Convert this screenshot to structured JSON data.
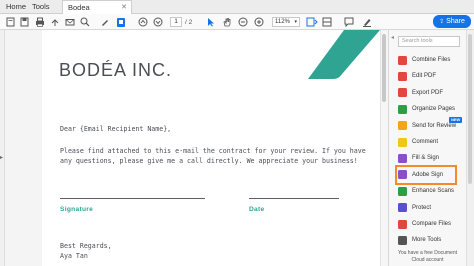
{
  "tabs": {
    "home": "Home",
    "tools": "Tools",
    "document": "Bodea Contract.pdf"
  },
  "toolbar": {
    "page_current": "1",
    "page_total": "/ 2",
    "zoom": "112%",
    "share_label": "Share"
  },
  "document": {
    "logo": "BODÉA INC.",
    "greeting": "Dear {Email Recipient Name},",
    "body_line1": "Please find attached to this e-mail the contract for your review. If you have",
    "body_line2": "any questions, please give me a call directly. We appreciate your business!",
    "signature_label": "Signature",
    "date_label": "Date",
    "closing": "Best Regards,",
    "closing_name": "Aya Tan",
    "accent_color": "#2fa492"
  },
  "tools_panel": {
    "search_placeholder": "Search tools",
    "items": [
      {
        "label": "Combine Files",
        "icon": "combine-files-icon",
        "color": "#e0473e"
      },
      {
        "label": "Edit PDF",
        "icon": "edit-pdf-icon",
        "color": "#e0473e"
      },
      {
        "label": "Export PDF",
        "icon": "export-pdf-icon",
        "color": "#e0473e"
      },
      {
        "label": "Organize Pages",
        "icon": "organize-pages-icon",
        "color": "#2e9e45"
      },
      {
        "label": "Send for Review",
        "icon": "send-for-review-icon",
        "color": "#f2a516"
      },
      {
        "label": "Comment",
        "icon": "comment-icon",
        "color": "#f2c516"
      },
      {
        "label": "Fill & Sign",
        "icon": "fill-sign-icon",
        "color": "#8a4fc9"
      },
      {
        "label": "Adobe Sign",
        "icon": "adobe-sign-icon",
        "color": "#8a4fc9"
      },
      {
        "label": "Enhance Scans",
        "icon": "enhance-scans-icon",
        "color": "#2e9e45"
      },
      {
        "label": "Protect",
        "icon": "protect-icon",
        "color": "#5a4fcf"
      },
      {
        "label": "Compare Files",
        "icon": "compare-files-icon",
        "color": "#e0473e"
      },
      {
        "label": "More Tools",
        "icon": "more-tools-icon",
        "color": "#555555"
      }
    ],
    "new_badge": "NEW",
    "free_note_line1": "You have a free Document",
    "free_note_line2": "Cloud account"
  }
}
